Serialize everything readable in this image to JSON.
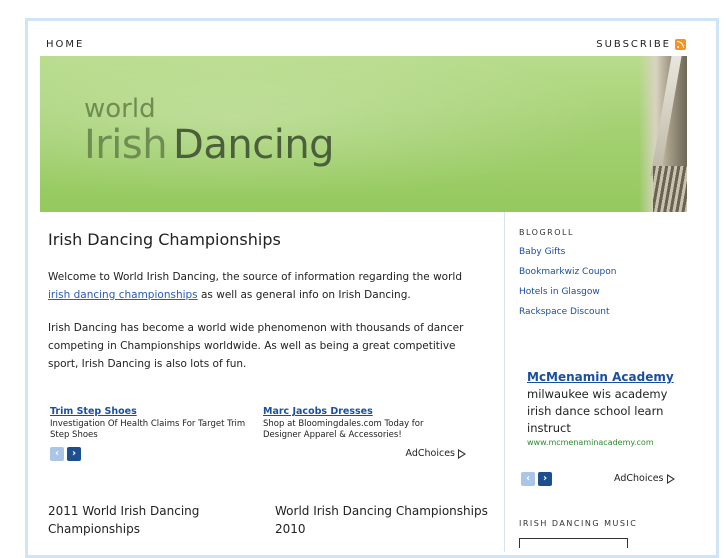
{
  "nav": {
    "home": "HOME",
    "subscribe": "SUBSCRIBE"
  },
  "icons": {
    "rss": "rss-feed-icon",
    "prev": "chevron-left-icon",
    "next": "chevron-right-icon",
    "adchoices": "adchoices-icon"
  },
  "colors": {
    "banner": "#a5d173",
    "link": "#1a4fa0",
    "frame": "#cfe4f4",
    "rss": "#f7931e"
  },
  "banner": {
    "world": "world",
    "irish": "Irish",
    "dancing": "Dancing"
  },
  "main": {
    "title": "Irish Dancing Championships",
    "p1_before": "Welcome to World Irish Dancing, the source of information regarding the world ",
    "p1_link": "irish dancing championships",
    "p1_after": " as well as general info on Irish Dancing.",
    "p2": "Irish Dancing has become a world wide phenomenon with thousands of dancer competing in Championships worldwide.   As well as being a great competitive sport, Irish Dancing is also lots of fun."
  },
  "ads": [
    {
      "title": "Trim Step Shoes",
      "desc": "Investigation Of Health Claims For Target Trim Step Shoes"
    },
    {
      "title": "Marc Jacobs Dresses",
      "desc": "Shop at Bloomingdales.com Today for Designer Apparel & Accessories!"
    }
  ],
  "adchoices": "AdChoices",
  "posts": [
    {
      "title": "2011 World Irish Dancing Championships"
    },
    {
      "title": "World Irish Dancing Championships 2010"
    }
  ],
  "sidebar": {
    "blogroll_heading": "Blogroll",
    "links": [
      "Baby Gifts",
      "Bookmarkwiz Coupon",
      "Hotels in Glasgow",
      "Rackspace Discount"
    ],
    "ad": {
      "title": "McMenamin Academy",
      "desc": "milwaukee wis academy irish dance school learn instruct",
      "url": "www.mcmenaminacademy.com"
    },
    "music_heading": "Irish Dancing Music"
  }
}
